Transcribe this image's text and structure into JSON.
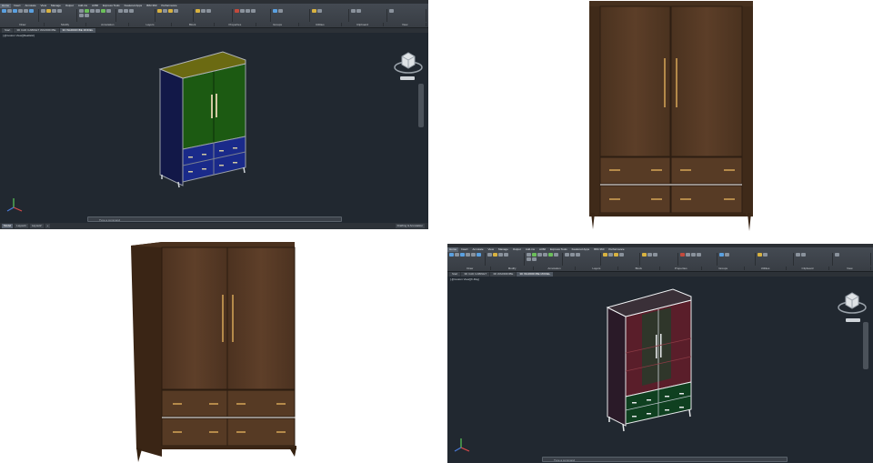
{
  "colors": {
    "acad_bg": "#212830",
    "walnut": "#5a3d28",
    "walnut_dark": "#3e2817",
    "brass": "#b58a4a",
    "acad_top": "#6b6a12",
    "acad_door": "#1c5a12",
    "acad_drawer": "#1a2a8a"
  },
  "cad_top": {
    "menu": [
      "Home",
      "Insert",
      "Annotate",
      "View",
      "Manage",
      "Output",
      "Add-ins",
      "A360",
      "Express Tools",
      "Featured Apps",
      "BIM 360",
      "Performance"
    ],
    "groups": [
      "Draw",
      "Modify",
      "Annotation",
      "Layers",
      "Block",
      "Properties",
      "Groups",
      "Utilities",
      "Clipboard",
      "View"
    ],
    "tabs": [
      "Start",
      "3D CAD CABINET WARDROBE",
      "3D WARDROBE MODEL"
    ],
    "view_label": "[-][Custom View][Realistic]",
    "command_placeholder": "Type a command",
    "status_tabs": [
      "Model",
      "Layout1",
      "Layout2"
    ],
    "status_right": "Drafting & Annotation"
  },
  "cad_bottom": {
    "menu": [
      "Home",
      "Insert",
      "Annotate",
      "View",
      "Manage",
      "Output",
      "Add-ins",
      "A360",
      "Express Tools",
      "Featured Apps",
      "BIM 360",
      "Performance"
    ],
    "groups": [
      "Draw",
      "Modify",
      "Annotation",
      "Layers",
      "Block",
      "Properties",
      "Groups",
      "Utilities",
      "Clipboard",
      "View"
    ],
    "tabs": [
      "Start",
      "3D CAD CABINET",
      "3D WARDROBE",
      "3D WARDROBE MODEL"
    ],
    "view_label": "[-][Custom View][X-Ray]",
    "command_placeholder": "Type a command"
  }
}
